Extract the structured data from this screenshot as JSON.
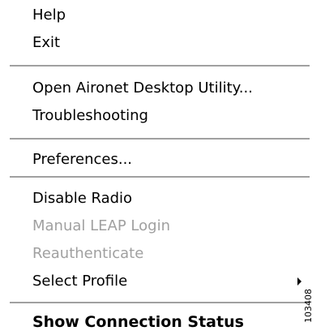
{
  "menu": {
    "items": [
      {
        "label": "Help"
      },
      {
        "label": "Exit"
      },
      {
        "label": "Open Aironet Desktop Utility..."
      },
      {
        "label": "Troubleshooting"
      },
      {
        "label": "Preferences..."
      },
      {
        "label": "Disable Radio"
      },
      {
        "label": "Manual LEAP Login",
        "state": "disabled"
      },
      {
        "label": "Reauthenticate",
        "state": "disabled"
      },
      {
        "label": "Select Profile",
        "submenu_icon": "submenu-arrow-icon"
      },
      {
        "label": "Show Connection Status",
        "style": "bold"
      }
    ]
  },
  "watermark": "103408",
  "colors": {
    "text": "#000000",
    "disabled_text": "#a0a0a0",
    "separator": "#a0a0a0",
    "background": "#ffffff"
  }
}
